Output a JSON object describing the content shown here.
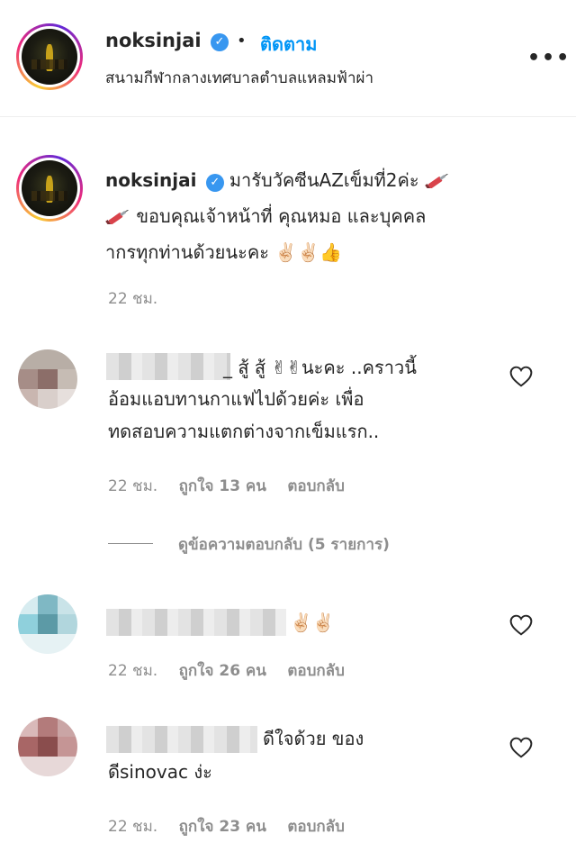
{
  "post_header": {
    "username": "noksinjai",
    "verified_icon": "verified-badge-icon",
    "separator": "•",
    "follow_label": "ติดตาม",
    "location": "สนามกีฬากลางเทศบาลตำบลแหลมฟ้าผ่า",
    "more_label": "•••"
  },
  "caption": {
    "username": "noksinjai",
    "line1": "มารับวัคซีนAZเข็มที่2ค่ะ",
    "line2": "ขอบคุณเจ้าหน้าที่ คุณหมอ และบุคคล",
    "line3": "ากรทุกท่านด้วยนะคะ",
    "emoji_peace": "✌🏻",
    "emoji_thumb": "👍",
    "time": "22 ชม."
  },
  "comments": [
    {
      "lines": [
        "_ สู้ สู้ ✌✌นะคะ ..คราวนี้",
        "อ้อมแอบทานกาแฟไปด้วยค่ะ เพื่อ",
        "ทดสอบความแตกต่างจากเข็มแรก.."
      ],
      "time": "22 ชม.",
      "likes": "ถูกใจ 13 คน",
      "reply": "ตอบกลับ"
    },
    {
      "lines": [
        "✌🏻✌🏻"
      ],
      "time": "22 ชม.",
      "likes": "ถูกใจ 26 คน",
      "reply": "ตอบกลับ"
    },
    {
      "lines": [
        "ดีใจด้วย ของ",
        "ดีsinovac ง่ะ"
      ],
      "time": "22 ชม.",
      "likes": "ถูกใจ 23 คน",
      "reply": "ตอบกลับ"
    }
  ],
  "view_replies": "ดูข้อความตอบกลับ (5 รายการ)",
  "icons": {
    "heart": "heart-outline-icon",
    "syringe": "syringe-icon"
  },
  "colors": {
    "link_blue": "#0095f6",
    "verified_blue": "#3897f0",
    "muted_gray": "#8e8e8e"
  }
}
